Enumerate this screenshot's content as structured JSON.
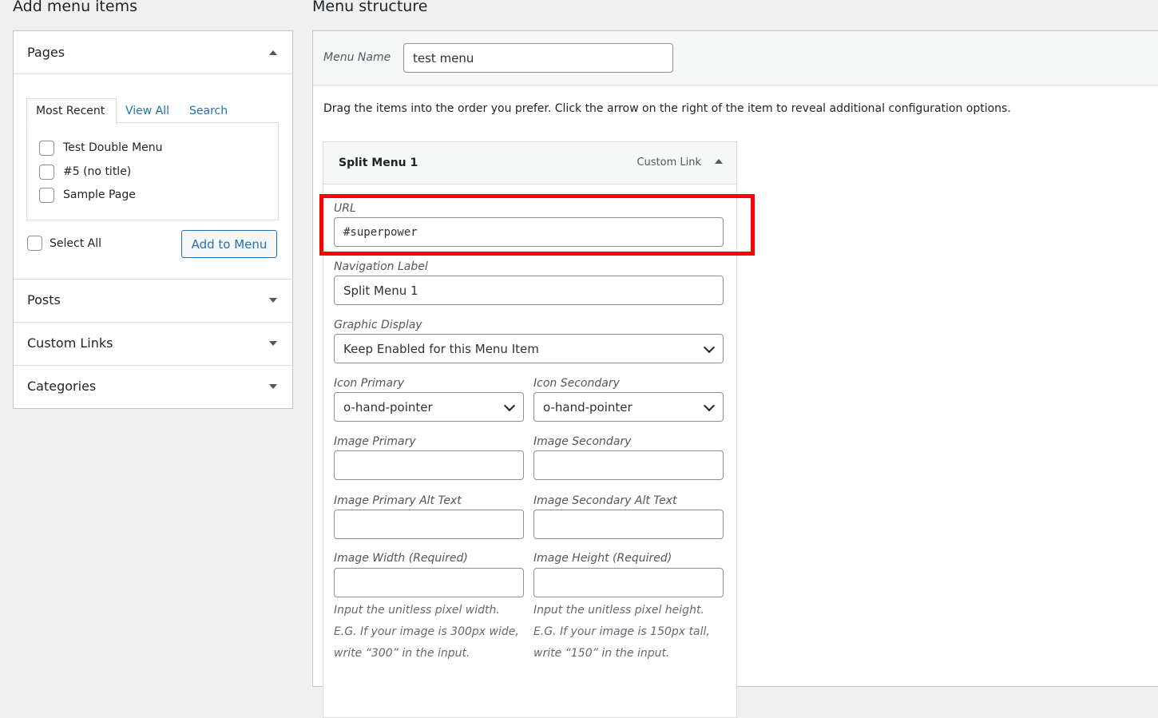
{
  "left": {
    "heading": "Add menu items",
    "pages": {
      "title": "Pages",
      "tabs": [
        "Most Recent",
        "View All",
        "Search"
      ],
      "items": [
        "Test Double Menu",
        "#5 (no title)",
        "Sample Page"
      ],
      "select_all": "Select All",
      "add_button": "Add to Menu"
    },
    "sections": [
      "Posts",
      "Custom Links",
      "Categories"
    ]
  },
  "right": {
    "heading": "Menu structure",
    "menu_name_label": "Menu Name",
    "menu_name_value": "test menu",
    "instructions": "Drag the items into the order you prefer. Click the arrow on the right of the item to reveal additional configuration options.",
    "item": {
      "title": "Split Menu 1",
      "type": "Custom Link",
      "url_label": "URL",
      "url_value": "#superpower",
      "nav_label": "Navigation Label",
      "nav_value": "Split Menu 1",
      "graphic_label": "Graphic Display",
      "graphic_value": "Keep Enabled for this Menu Item",
      "icon_primary_label": "Icon Primary",
      "icon_primary_value": "o-hand-pointer",
      "icon_secondary_label": "Icon Secondary",
      "icon_secondary_value": "o-hand-pointer",
      "image_primary_label": "Image Primary",
      "image_secondary_label": "Image Secondary",
      "image_primary_alt_label": "Image Primary Alt Text",
      "image_secondary_alt_label": "Image Secondary Alt Text",
      "image_width_label": "Image Width (Required)",
      "image_height_label": "Image Height (Required)",
      "width_desc": "Input the unitless pixel width. E.G. If your image is 300px wide, write “300” in the input.",
      "height_desc": "Input the unitless pixel height. E.G. If your image is 150px tall, write “150” in the input."
    }
  },
  "colors": {
    "link": "#2271b1",
    "highlight": "#ff0000"
  }
}
